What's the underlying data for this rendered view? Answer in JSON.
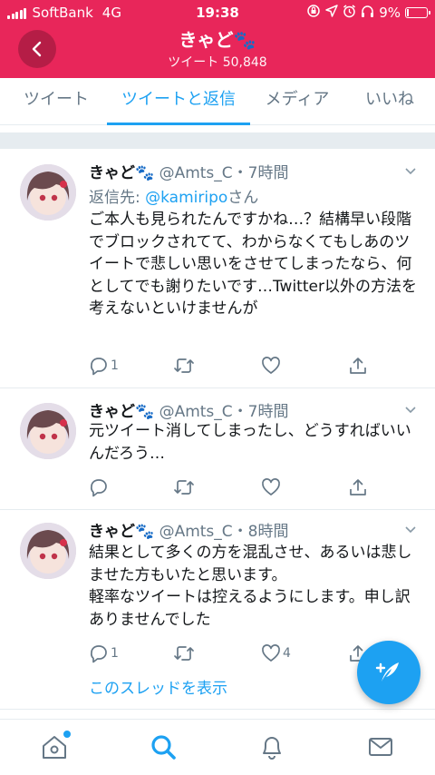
{
  "status_bar": {
    "carrier": "SoftBank",
    "network": "4G",
    "time": "19:38",
    "battery": "9%"
  },
  "header": {
    "title": "きゃど🐾",
    "tweet_count": "ツイート 50,848",
    "color": "#e8265a"
  },
  "tabs": [
    {
      "label": "ツイート",
      "active": false
    },
    {
      "label": "ツイートと返信",
      "active": true
    },
    {
      "label": "メディア",
      "active": false
    },
    {
      "label": "いいね",
      "active": false
    }
  ],
  "tweets": [
    {
      "name": "きゃど🐾",
      "meta": "@Amts_C・7時間",
      "reply_prefix": "返信先: ",
      "reply_mention": "@kamiripo",
      "reply_suffix": "さん",
      "text": "ご本人も見られたんですかね…？結構早い段階でブロックされてて、わからなくてもしあのツイートで悲しい思いをさせてしまったなら、何としてでも謝りたいです…Twitter以外の方法を考えないといけませんが",
      "reply_count": "1",
      "retweet_count": "",
      "like_count": ""
    },
    {
      "name": "きゃど🐾",
      "meta": "@Amts_C・7時間",
      "text": "元ツイート消してしまったし、どうすればいいんだろう…",
      "reply_count": "",
      "retweet_count": "",
      "like_count": ""
    },
    {
      "name": "きゃど🐾",
      "meta": "@Amts_C・8時間",
      "text_line1": "結果として多くの方を混乱させ、あるいは悲しませた方もいたと思います。",
      "text_line2": "軽率なツイートは控えるようにします。申し訳ありませんでした",
      "reply_count": "1",
      "retweet_count": "",
      "like_count": "4",
      "show_thread": "このスレッドを表示"
    }
  ],
  "accent_color": "#1da1f2",
  "icons": {
    "back": "chevron-left-icon",
    "reply": "reply-bubble-icon",
    "retweet": "retweet-icon",
    "like": "heart-icon",
    "share": "share-icon",
    "compose": "compose-feather-icon",
    "nav": [
      "home-icon",
      "search-icon",
      "bell-icon",
      "mail-icon"
    ]
  }
}
